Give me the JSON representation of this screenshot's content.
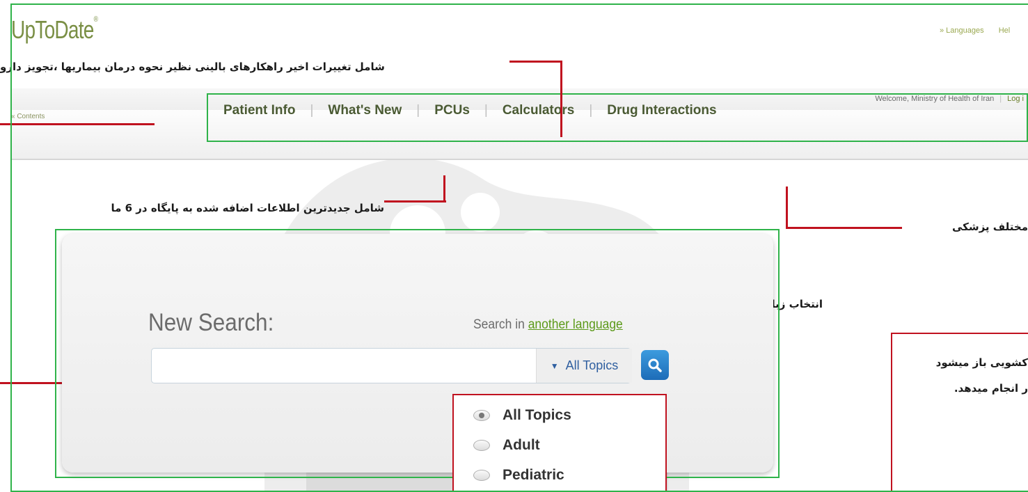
{
  "header": {
    "logo": "UpToDate",
    "logo_mark": "®",
    "links": [
      "» Languages",
      "Hel"
    ],
    "welcome": "Welcome, Ministry of Health of Iran",
    "login": "Log i",
    "contents": "« Contents"
  },
  "nav": {
    "items": [
      "Patient Info",
      "What's New",
      "PCUs",
      "Calculators",
      "Drug Interactions"
    ],
    "divider": "|"
  },
  "annotations": {
    "top": "شامل تغییرات اخیر راهکارهای بالینی نظیر نحوه درمان بیماریها ،تجویز دارو",
    "middle": "شامل جدیدترین اطلاعات اضافه شده به پایگاه در 6 ما",
    "right": "مختلف پزشکی",
    "language": "انتخاب  زبانهای دیگر",
    "box_line1": "کشویی  باز میشود",
    "box_line2": "ر انجام میدهد."
  },
  "search": {
    "title": "New Search:",
    "lang_prefix": "Search in ",
    "lang_link": "another language",
    "input_value": "",
    "scope": "All Topics",
    "button_icon": "search-icon"
  },
  "dropdown": {
    "options": [
      {
        "label": "All Topics",
        "selected": true
      },
      {
        "label": "Adult",
        "selected": false
      },
      {
        "label": "Pediatric",
        "selected": false
      }
    ]
  },
  "colors": {
    "frame_green": "#2fb34a",
    "annotation_red": "#c0121f",
    "nav_text": "#4a5a33",
    "link_green": "#5c9a1a",
    "button_blue": "#1d6cb8"
  }
}
